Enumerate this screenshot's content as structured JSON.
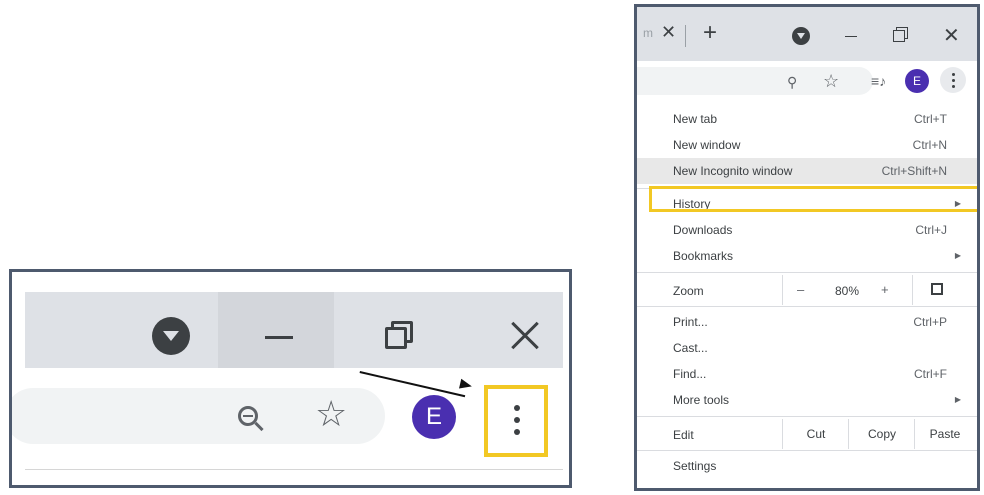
{
  "zoomed_view": {
    "avatar_letter": "E",
    "icons": [
      "tab-search-icon",
      "minimize-icon",
      "restore-icon",
      "close-icon",
      "zoom-out-icon",
      "star-icon",
      "more-vert-icon"
    ],
    "highlight_color": "#f2c824"
  },
  "browser": {
    "avatar_letter": "E",
    "accent_avatar": "#4a2fb0",
    "tab_edge_text": "m"
  },
  "menu": {
    "items_top": [
      {
        "label": "New tab",
        "shortcut": "Ctrl+T"
      },
      {
        "label": "New window",
        "shortcut": "Ctrl+N"
      },
      {
        "label": "New Incognito window",
        "shortcut": "Ctrl+Shift+N"
      }
    ],
    "items_mid": [
      {
        "label": "History",
        "shortcut": ""
      },
      {
        "label": "Downloads",
        "shortcut": "Ctrl+J"
      },
      {
        "label": "Bookmarks",
        "shortcut": ""
      }
    ],
    "zoom": {
      "label": "Zoom",
      "minus": "–",
      "value": "80%",
      "plus": "+"
    },
    "items_tools": [
      {
        "label": "Print...",
        "shortcut": "Ctrl+P"
      },
      {
        "label": "Cast...",
        "shortcut": ""
      },
      {
        "label": "Find...",
        "shortcut": "Ctrl+F"
      },
      {
        "label": "More tools",
        "shortcut": ""
      }
    ],
    "edit": {
      "label": "Edit",
      "cut": "Cut",
      "copy": "Copy",
      "paste": "Paste"
    },
    "settings": "Settings"
  }
}
